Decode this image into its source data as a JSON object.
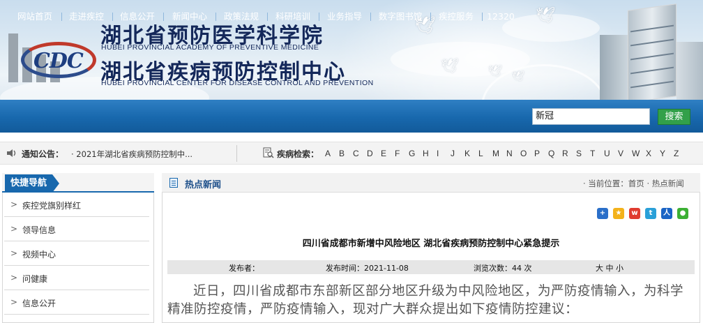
{
  "header": {
    "logo_text": "CDC",
    "title_cn_1": "湖北省预防医学科学院",
    "title_en_1": "HUBEI PROVINCIAL ACADEMY OF PREVENTIVE MEDICINE",
    "title_cn_2": "湖北省疾病预防控制中心",
    "title_en_2": "HUBEI PROVINCIAL CENTER FOR DISEASE CONTROL AND PREVENTION"
  },
  "nav": {
    "items": [
      "网站首页",
      "走进疾控",
      "信息公开",
      "新闻中心",
      "政策法规",
      "科研培训",
      "业务指导",
      "数字图书馆",
      "疾控服务",
      "12320"
    ],
    "search_value": "新冠",
    "search_button": "搜索"
  },
  "notice": {
    "label": "通知公告：",
    "text": "· 2021年湖北省疾病预防控制中...",
    "disease_label": "疾病检索：",
    "letters": [
      "A",
      "B",
      "C",
      "D",
      "E",
      "F",
      "G",
      "H",
      "I",
      "J",
      "K",
      "L",
      "M",
      "N",
      "O",
      "P",
      "Q",
      "R",
      "S",
      "T",
      "U",
      "V",
      "W",
      "X",
      "Y",
      "Z"
    ]
  },
  "sidebar": {
    "title": "快捷导航",
    "items": [
      "疾控党旗别样红",
      "领导信息",
      "视频中心",
      "问健康",
      "信息公开"
    ]
  },
  "main": {
    "section_title": "热点新闻",
    "breadcrumb": "· 当前位置：首页 · 热点新闻",
    "article_title": "四川省成都市新增中风险地区  湖北省疾病预防控制中心紧急提示",
    "meta": {
      "publisher": "发布者：",
      "date": "发布时间：2021-11-08",
      "views": "浏览次数：44 次",
      "font_size": "大 中 小"
    },
    "body": "近日，四川省成都市东部新区部分地区升级为中风险地区，为严防疫情输入，为科学精准防控疫情，严防疫情输入，现对广大群众提出如下疫情防控建议："
  },
  "colors": {
    "nav_blue": "#1868ad",
    "search_green": "#32a04a",
    "title_navy": "#14285a"
  },
  "share_icons": [
    "plus-share-icon",
    "qzone-icon",
    "weibo-icon",
    "tencent-weibo-icon",
    "renren-icon",
    "wechat-icon"
  ]
}
